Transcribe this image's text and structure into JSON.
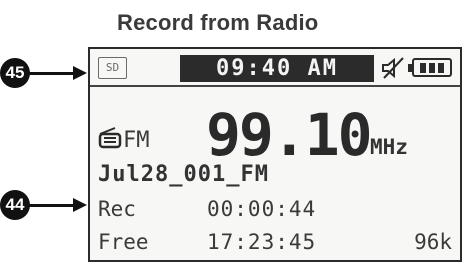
{
  "title": "Record from Radio",
  "callouts": {
    "top": "45",
    "bottom": "44"
  },
  "status_bar": {
    "sd_label": "SD",
    "time": "09:40 AM",
    "muted": true,
    "battery_bars": 3
  },
  "tuner": {
    "band": "FM",
    "frequency": "99.10",
    "unit": "MHz"
  },
  "recording": {
    "filename": "Jul28_001_FM",
    "rec_label": "Rec",
    "rec_time": "00:00:44",
    "free_label": "Free",
    "free_time": "17:23:45",
    "bitrate": "96k"
  }
}
